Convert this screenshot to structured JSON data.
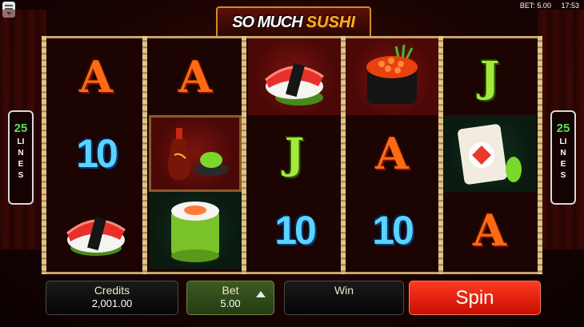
{
  "status_bar": {
    "bet": "BET: 5.00",
    "time": "17:53"
  },
  "game": {
    "title_part1": "SO MUCH",
    "title_part2": "SUSHI"
  },
  "paylines": {
    "count": "25",
    "label": "LINES"
  },
  "reels": [
    [
      "A",
      "10",
      "salmon-nigiri"
    ],
    [
      "A",
      "soy-sauce-wasabi",
      "salmon-maki-roll"
    ],
    [
      "salmon-nigiri",
      "J",
      "10"
    ],
    [
      "salmon-roe-gunkan",
      "A",
      "10"
    ],
    [
      "J",
      "california-roll",
      "A"
    ]
  ],
  "symbols": {
    "A": "A",
    "J": "J",
    "10": "10"
  },
  "panels": {
    "credits_label": "Credits",
    "credits_value": "2,001.00",
    "bet_label": "Bet",
    "bet_value": "5.00",
    "win_label": "Win",
    "win_value": "",
    "spin_label": "Spin"
  },
  "colors": {
    "accent_spin": "#e81e0c",
    "bet_green": "#3c5a22",
    "lines_green": "#5ae05a"
  }
}
